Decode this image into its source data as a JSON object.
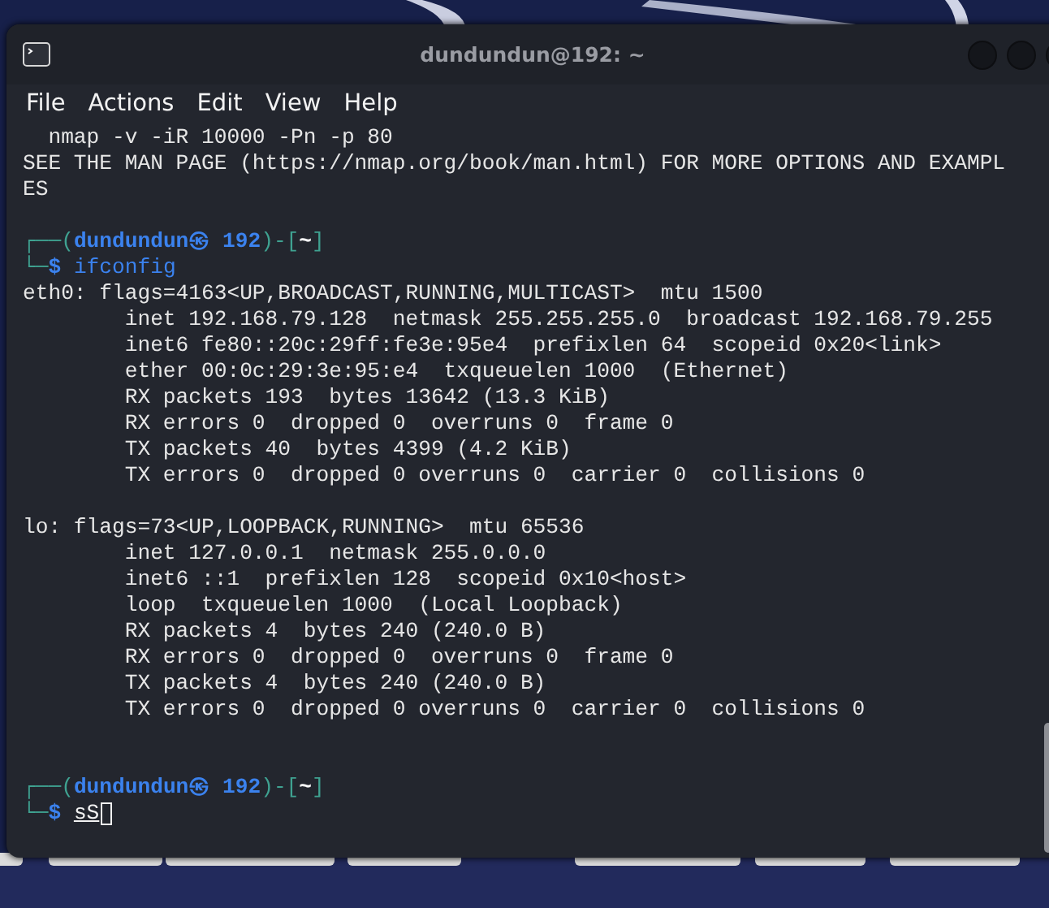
{
  "window": {
    "title": "dundundun@192: ~"
  },
  "menu": [
    "File",
    "Actions",
    "Edit",
    "View",
    "Help"
  ],
  "terminal": {
    "lines": [
      {
        "kind": "output",
        "text": "  nmap -v -iR 10000 -Pn -p 80"
      },
      {
        "kind": "output",
        "text": "SEE THE MAN PAGE (https://nmap.org/book/man.html) FOR MORE OPTIONS AND EXAMPL"
      },
      {
        "kind": "output",
        "text": "ES"
      },
      {
        "kind": "blank"
      },
      {
        "kind": "prompt",
        "open": "┌──(",
        "user": "dundundun",
        "at": "㉿",
        "host": "192",
        "mid": ")-[",
        "path": "~",
        "close": "]"
      },
      {
        "kind": "command",
        "corner": "└─",
        "symbol": "$",
        "command": "ifconfig",
        "underlined": false,
        "cursor": false
      },
      {
        "kind": "output",
        "text": "eth0: flags=4163<UP,BROADCAST,RUNNING,MULTICAST>  mtu 1500"
      },
      {
        "kind": "output",
        "text": "        inet 192.168.79.128  netmask 255.255.255.0  broadcast 192.168.79.255"
      },
      {
        "kind": "output",
        "text": "        inet6 fe80::20c:29ff:fe3e:95e4  prefixlen 64  scopeid 0x20<link>"
      },
      {
        "kind": "output",
        "text": "        ether 00:0c:29:3e:95:e4  txqueuelen 1000  (Ethernet)"
      },
      {
        "kind": "output",
        "text": "        RX packets 193  bytes 13642 (13.3 KiB)"
      },
      {
        "kind": "output",
        "text": "        RX errors 0  dropped 0  overruns 0  frame 0"
      },
      {
        "kind": "output",
        "text": "        TX packets 40  bytes 4399 (4.2 KiB)"
      },
      {
        "kind": "output",
        "text": "        TX errors 0  dropped 0 overruns 0  carrier 0  collisions 0"
      },
      {
        "kind": "blank"
      },
      {
        "kind": "output",
        "text": "lo: flags=73<UP,LOOPBACK,RUNNING>  mtu 65536"
      },
      {
        "kind": "output",
        "text": "        inet 127.0.0.1  netmask 255.0.0.0"
      },
      {
        "kind": "output",
        "text": "        inet6 ::1  prefixlen 128  scopeid 0x10<host>"
      },
      {
        "kind": "output",
        "text": "        loop  txqueuelen 1000  (Local Loopback)"
      },
      {
        "kind": "output",
        "text": "        RX packets 4  bytes 240 (240.0 B)"
      },
      {
        "kind": "output",
        "text": "        RX errors 0  dropped 0  overruns 0  frame 0"
      },
      {
        "kind": "output",
        "text": "        TX packets 4  bytes 240 (240.0 B)"
      },
      {
        "kind": "output",
        "text": "        TX errors 0  dropped 0 overruns 0  carrier 0  collisions 0"
      },
      {
        "kind": "blank"
      },
      {
        "kind": "blank"
      },
      {
        "kind": "prompt",
        "open": "┌──(",
        "user": "dundundun",
        "at": "㉿",
        "host": "192",
        "mid": ")-[",
        "path": "~",
        "close": "]"
      },
      {
        "kind": "command",
        "corner": "└─",
        "symbol": "$",
        "command": "sS",
        "underlined": true,
        "cursor": true
      }
    ]
  }
}
